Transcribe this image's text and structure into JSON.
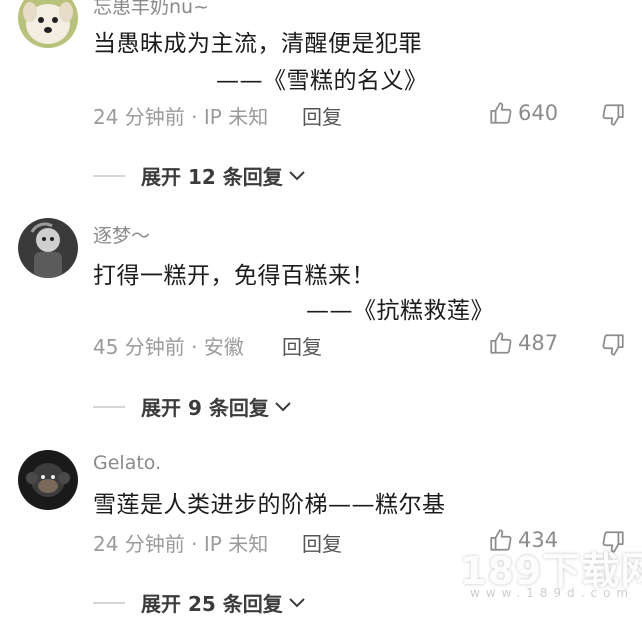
{
  "comments": [
    {
      "username": "忘患丰奶nu~",
      "lines": [
        "当愚昧成为主流，清醒便是犯罪",
        "——《雪糕的名义》"
      ],
      "meta": "24 分钟前 · IP 未知",
      "reply_label": "回复",
      "likes": "640",
      "expand_label": "展开 12 条回复"
    },
    {
      "username": "逐梦～",
      "lines": [
        "打得一糕开，免得百糕来！",
        "——《抗糕救莲》"
      ],
      "meta": "45 分钟前 · 安徽",
      "reply_label": "回复",
      "likes": "487",
      "expand_label": "展开 9 条回复"
    },
    {
      "username": "Gelato.",
      "lines": [
        "雪莲是人类进步的阶梯——糕尔基"
      ],
      "meta": "24 分钟前 · IP 未知",
      "reply_label": "回复",
      "likes": "434",
      "expand_label": "展开 25 条回复"
    }
  ],
  "watermark": {
    "main": "189下载网",
    "sub": "www.189d.com"
  },
  "icons": {
    "avatar_1": "dog-avatar",
    "avatar_2": "cartoon-person-avatar",
    "avatar_3": "monkey-avatar",
    "like": "thumbs-up-icon",
    "dislike": "thumbs-down-icon",
    "expand": "chevron-down-icon"
  }
}
